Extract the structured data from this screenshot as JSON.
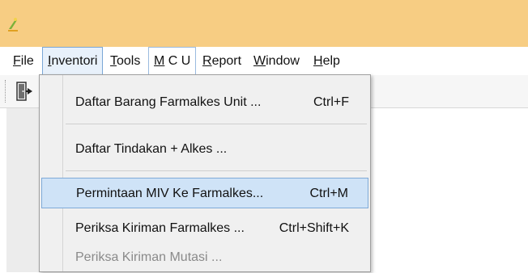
{
  "menubar": {
    "items": [
      {
        "pre": "",
        "mnem": "F",
        "post": "ile"
      },
      {
        "pre": "",
        "mnem": "I",
        "post": "nventori"
      },
      {
        "pre": "",
        "mnem": "T",
        "post": "ools"
      },
      {
        "pre": "",
        "mnem": "M",
        "post": " C U"
      },
      {
        "pre": "",
        "mnem": "R",
        "post": "eport"
      },
      {
        "pre": "",
        "mnem": "W",
        "post": "indow"
      },
      {
        "pre": "",
        "mnem": "H",
        "post": "elp"
      }
    ]
  },
  "inventori_menu": {
    "items": [
      {
        "label": "Daftar Barang Farmalkes Unit ...",
        "shortcut": "Ctrl+F"
      },
      {
        "label": "Daftar Tindakan + Alkes ...",
        "shortcut": ""
      },
      {
        "label": "Permintaan MIV Ke Farmalkes...",
        "shortcut": "Ctrl+M"
      },
      {
        "label": "Periksa Kiriman Farmalkes ...",
        "shortcut": "Ctrl+Shift+K"
      },
      {
        "label": "Periksa  Kiriman Mutasi ...",
        "shortcut": ""
      }
    ]
  },
  "colors": {
    "titlebar": "#f7cd83",
    "selection": "#cfe3f7",
    "selection_border": "#7faad8"
  },
  "icons": {
    "app": "app-logo-icon",
    "toolbar": "exit-door-icon"
  }
}
